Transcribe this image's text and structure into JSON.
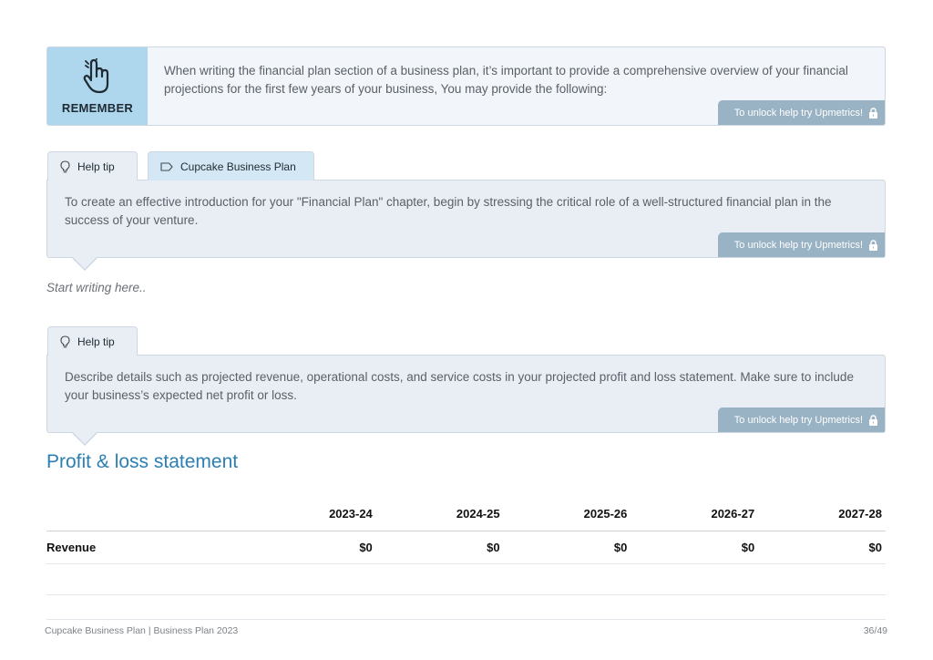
{
  "remember": {
    "label": "REMEMBER",
    "text": "When writing the financial plan section of a business plan, it’s important to provide a comprehensive overview of your financial projections for the first few years of your business, You may provide the following:",
    "unlock": "To unlock help try Upmetrics!"
  },
  "tip1": {
    "tab_help": "Help tip",
    "tab_plan": "Cupcake Business Plan",
    "text": "To create an effective introduction for your \"Financial Plan\" chapter, begin by stressing the critical role of a well-structured financial plan in the success of your venture.",
    "unlock": "To unlock help try Upmetrics!"
  },
  "editor": {
    "placeholder": "Start writing here.."
  },
  "tip2": {
    "tab_help": "Help tip",
    "text": "Describe details such as projected revenue, operational costs, and service costs in your projected profit and loss statement. Make sure to include your business’s expected net profit or loss.",
    "unlock": "To unlock help try Upmetrics!"
  },
  "pl": {
    "title": "Profit & loss statement",
    "columns": [
      "2023-24",
      "2024-25",
      "2025-26",
      "2026-27",
      "2027-28"
    ],
    "rows": [
      {
        "label": "Revenue",
        "values": [
          "$0",
          "$0",
          "$0",
          "$0",
          "$0"
        ]
      }
    ]
  },
  "footer": {
    "left": "Cupcake Business Plan | Business Plan 2023",
    "right": "36/49"
  },
  "colors": {
    "accent": "#2a7fb3",
    "remember_side": "#aed6ed",
    "tip_bg": "#e9eef5",
    "unlock_bg": "#99b3c4"
  }
}
